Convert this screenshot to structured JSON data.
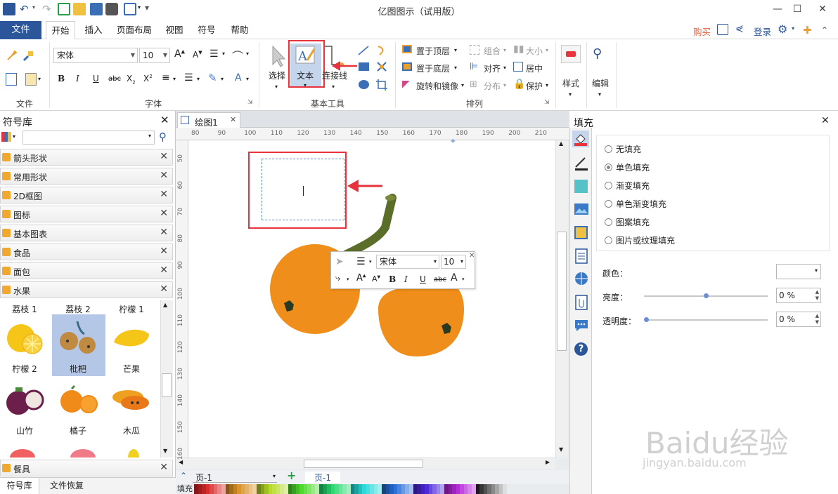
{
  "app": {
    "title": "亿图图示（试用版）"
  },
  "menu": {
    "file": "文件",
    "tabs": [
      "开始",
      "插入",
      "页面布局",
      "视图",
      "符号",
      "帮助"
    ],
    "buy": "购买",
    "login": "登录"
  },
  "ribbon": {
    "font_name": "宋体",
    "font_size": "10",
    "select_label": "选择",
    "text_label": "文本",
    "connector_label": "连接线",
    "bring_front": "置于顶层",
    "send_back": "置于底层",
    "rotate_mirror": "旋转和镜像",
    "group": "组合",
    "align": "对齐",
    "distribute": "分布",
    "size": "大小",
    "center": "居中",
    "protect": "保护",
    "style": "样式",
    "edit": "编辑",
    "groups": {
      "file": "文件",
      "font": "字体",
      "basic_tools": "基本工具",
      "arrange": "排列"
    }
  },
  "symbol_library": {
    "title": "符号库",
    "categories": [
      "箭头形状",
      "常用形状",
      "2D框图",
      "图标",
      "基本图表",
      "食品",
      "面包",
      "水果"
    ],
    "fruits_top": [
      "荔枝 1",
      "荔枝 2",
      "柠檬 1"
    ],
    "fruits": [
      {
        "label": "柠檬 2"
      },
      {
        "label": "枇杷"
      },
      {
        "label": "芒果"
      },
      {
        "label": "山竹"
      },
      {
        "label": "橘子"
      },
      {
        "label": "木瓜"
      }
    ],
    "bottom_category": "餐具",
    "tabs": [
      "符号库",
      "文件恢复"
    ]
  },
  "canvas": {
    "doc_tab": "绘图1",
    "ruler_h": [
      "80",
      "90",
      "100",
      "110",
      "120",
      "130",
      "140",
      "150",
      "160",
      "170",
      "180",
      "190",
      "200",
      "210"
    ],
    "ruler_v": [
      "50",
      "60",
      "70",
      "80",
      "90",
      "100",
      "110",
      "120",
      "130",
      "140",
      "150",
      "160"
    ],
    "float_font": "宋体",
    "float_size": "10",
    "page_selector": "页-1",
    "page_tab": "页-1",
    "fill_label": "填充"
  },
  "fill_panel": {
    "title": "填充",
    "options": [
      "无填充",
      "单色填充",
      "渐变填充",
      "单色渐变填充",
      "图案填充",
      "图片或纹理填充"
    ],
    "selected_option": "单色填充",
    "color_label": "颜色：",
    "brightness_label": "亮度：",
    "brightness_value": "0 %",
    "brightness_level": 0.5,
    "transparency_label": "透明度：",
    "transparency_value": "0 %",
    "transparency_level": 0.0
  },
  "watermark": {
    "text": "Baidu经验",
    "url": "jingyan.baidu.com"
  },
  "colors": {
    "file_tab": "#2b579a",
    "highlight": "#e8323c",
    "fruit": "#ef8e1a",
    "stem": "#5a6e2a"
  }
}
